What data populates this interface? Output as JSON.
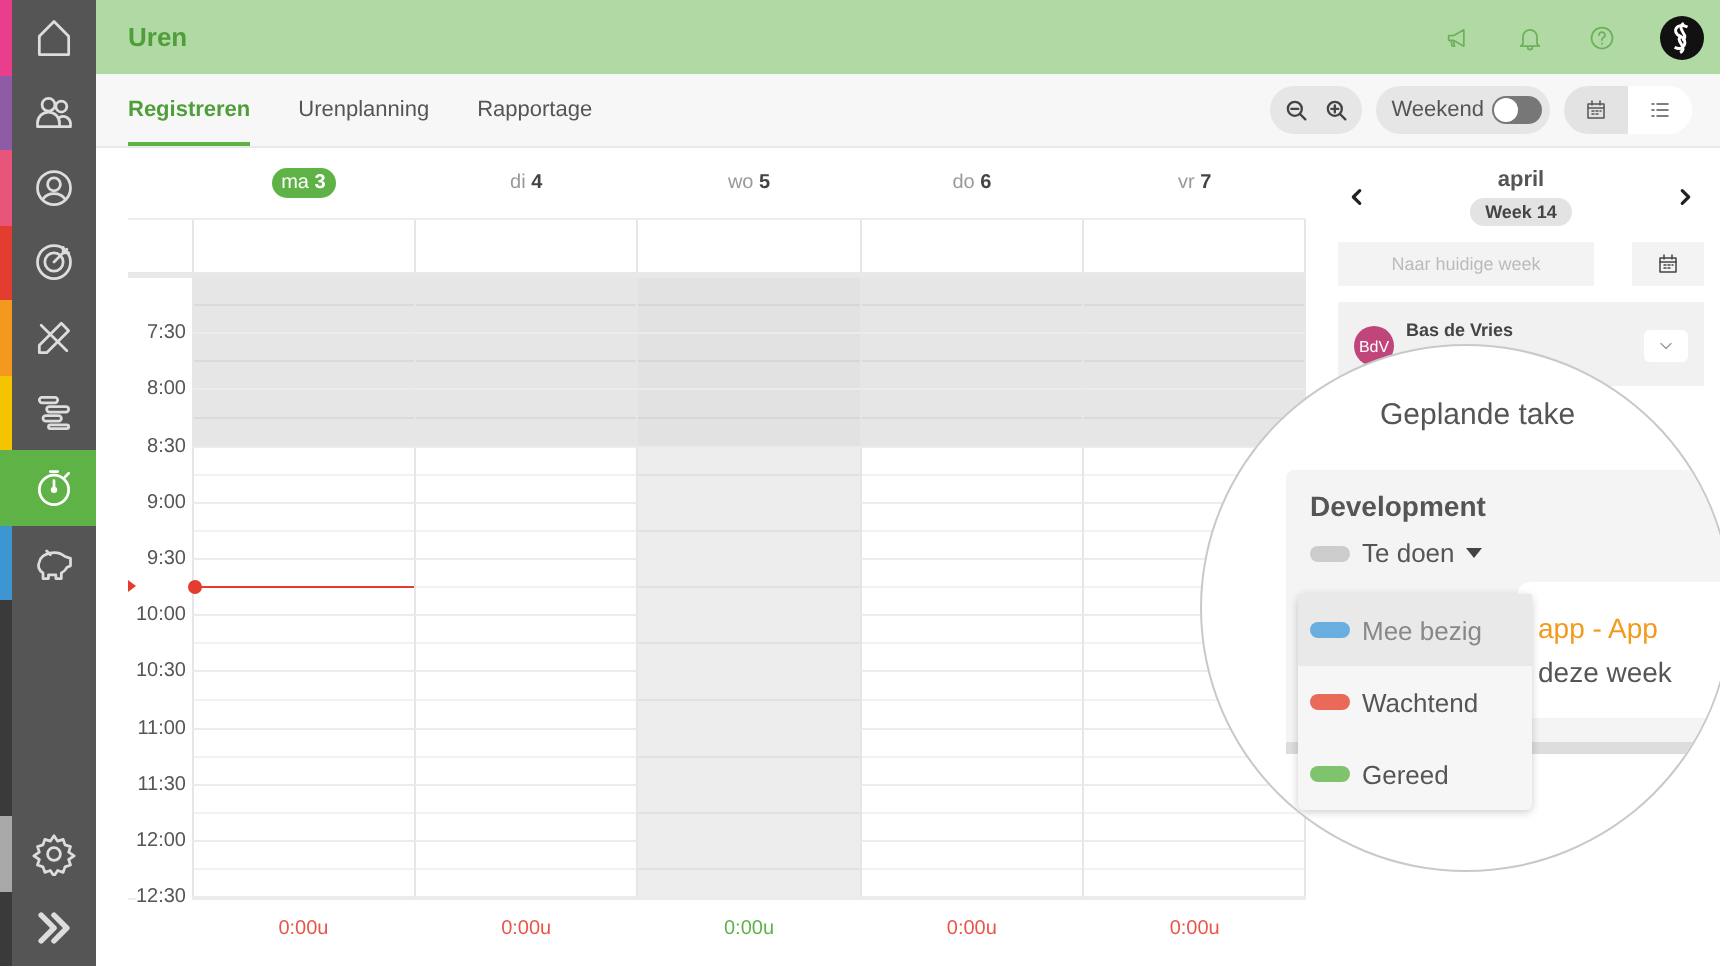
{
  "sidebar": {
    "items": [
      {
        "color": "#e83e8c",
        "selected": false
      },
      {
        "color": "#8e5ba6",
        "selected": false
      },
      {
        "color": "#e9557a",
        "selected": false
      },
      {
        "color": "#e23d2f",
        "selected": false
      },
      {
        "color": "#f39a1e",
        "selected": false
      },
      {
        "color": "#f5c400",
        "selected": false
      },
      {
        "color": "#5fb246",
        "selected": true
      },
      {
        "color": "#3d95d2",
        "selected": false
      }
    ],
    "bottom_items": [
      {
        "color": "#a8a8a8"
      },
      {
        "color": "#3a3a3a"
      }
    ]
  },
  "header": {
    "title": "Uren"
  },
  "tabs": [
    {
      "label": "Registreren",
      "selected": true
    },
    {
      "label": "Urenplanning",
      "selected": false
    },
    {
      "label": "Rapportage",
      "selected": false
    }
  ],
  "toolbar": {
    "weekend": {
      "label": "Weekend",
      "on": false
    },
    "views": [
      {
        "selected": true
      },
      {
        "selected": false
      }
    ]
  },
  "days": [
    {
      "weekday": "ma",
      "date": "3",
      "selected": true,
      "shaded": false,
      "total": "0:00u",
      "color": "#e8564a"
    },
    {
      "weekday": "di",
      "date": "4",
      "selected": false,
      "shaded": false,
      "total": "0:00u",
      "color": "#e8564a"
    },
    {
      "weekday": "wo",
      "date": "5",
      "selected": false,
      "shaded": true,
      "total": "0:00u",
      "color": "#5fb246"
    },
    {
      "weekday": "do",
      "date": "6",
      "selected": false,
      "shaded": false,
      "total": "0:00u",
      "color": "#e8564a"
    },
    {
      "weekday": "vr",
      "date": "7",
      "selected": false,
      "shaded": false,
      "total": "0:00u",
      "color": "#e8564a"
    }
  ],
  "time_slots": [
    {
      "label": "7:30",
      "off_hours": true,
      "now": false
    },
    {
      "label": "8:00",
      "off_hours": true,
      "now": false
    },
    {
      "label": "8:30",
      "off_hours": true,
      "now": false
    },
    {
      "label": "9:00",
      "off_hours": false,
      "now": false
    },
    {
      "label": "9:30",
      "off_hours": false,
      "now": false
    },
    {
      "label": "10:00",
      "off_hours": false,
      "now": true
    },
    {
      "label": "10:30",
      "off_hours": false,
      "now": false
    },
    {
      "label": "11:00",
      "off_hours": false,
      "now": false
    },
    {
      "label": "11:30",
      "off_hours": false,
      "now": false
    },
    {
      "label": "12:00",
      "off_hours": false,
      "now": false
    },
    {
      "label": "12:30",
      "off_hours": false,
      "now": false
    }
  ],
  "week_nav": {
    "month": "april",
    "week": "Week 14",
    "current_week_button": {
      "label": "Naar huidige week",
      "disabled": true
    }
  },
  "user_card": {
    "initials": "BdV",
    "name": "Bas de Vries"
  },
  "magnifier": {
    "heading": "Geplande take",
    "group": "Development",
    "status": {
      "label": "Te doen",
      "color": "#cccccc"
    },
    "behind_texts": [
      {
        "text": "app - App",
        "kind": "link"
      },
      {
        "text": "deze week",
        "kind": "plain"
      }
    ],
    "menu": [
      {
        "label": "Mee bezig",
        "color": "#6aaee0",
        "selected": true
      },
      {
        "label": "Wachtend",
        "color": "#ea6a5a",
        "selected": false
      },
      {
        "label": "Gereed",
        "color": "#7fc46c",
        "selected": false
      }
    ]
  }
}
